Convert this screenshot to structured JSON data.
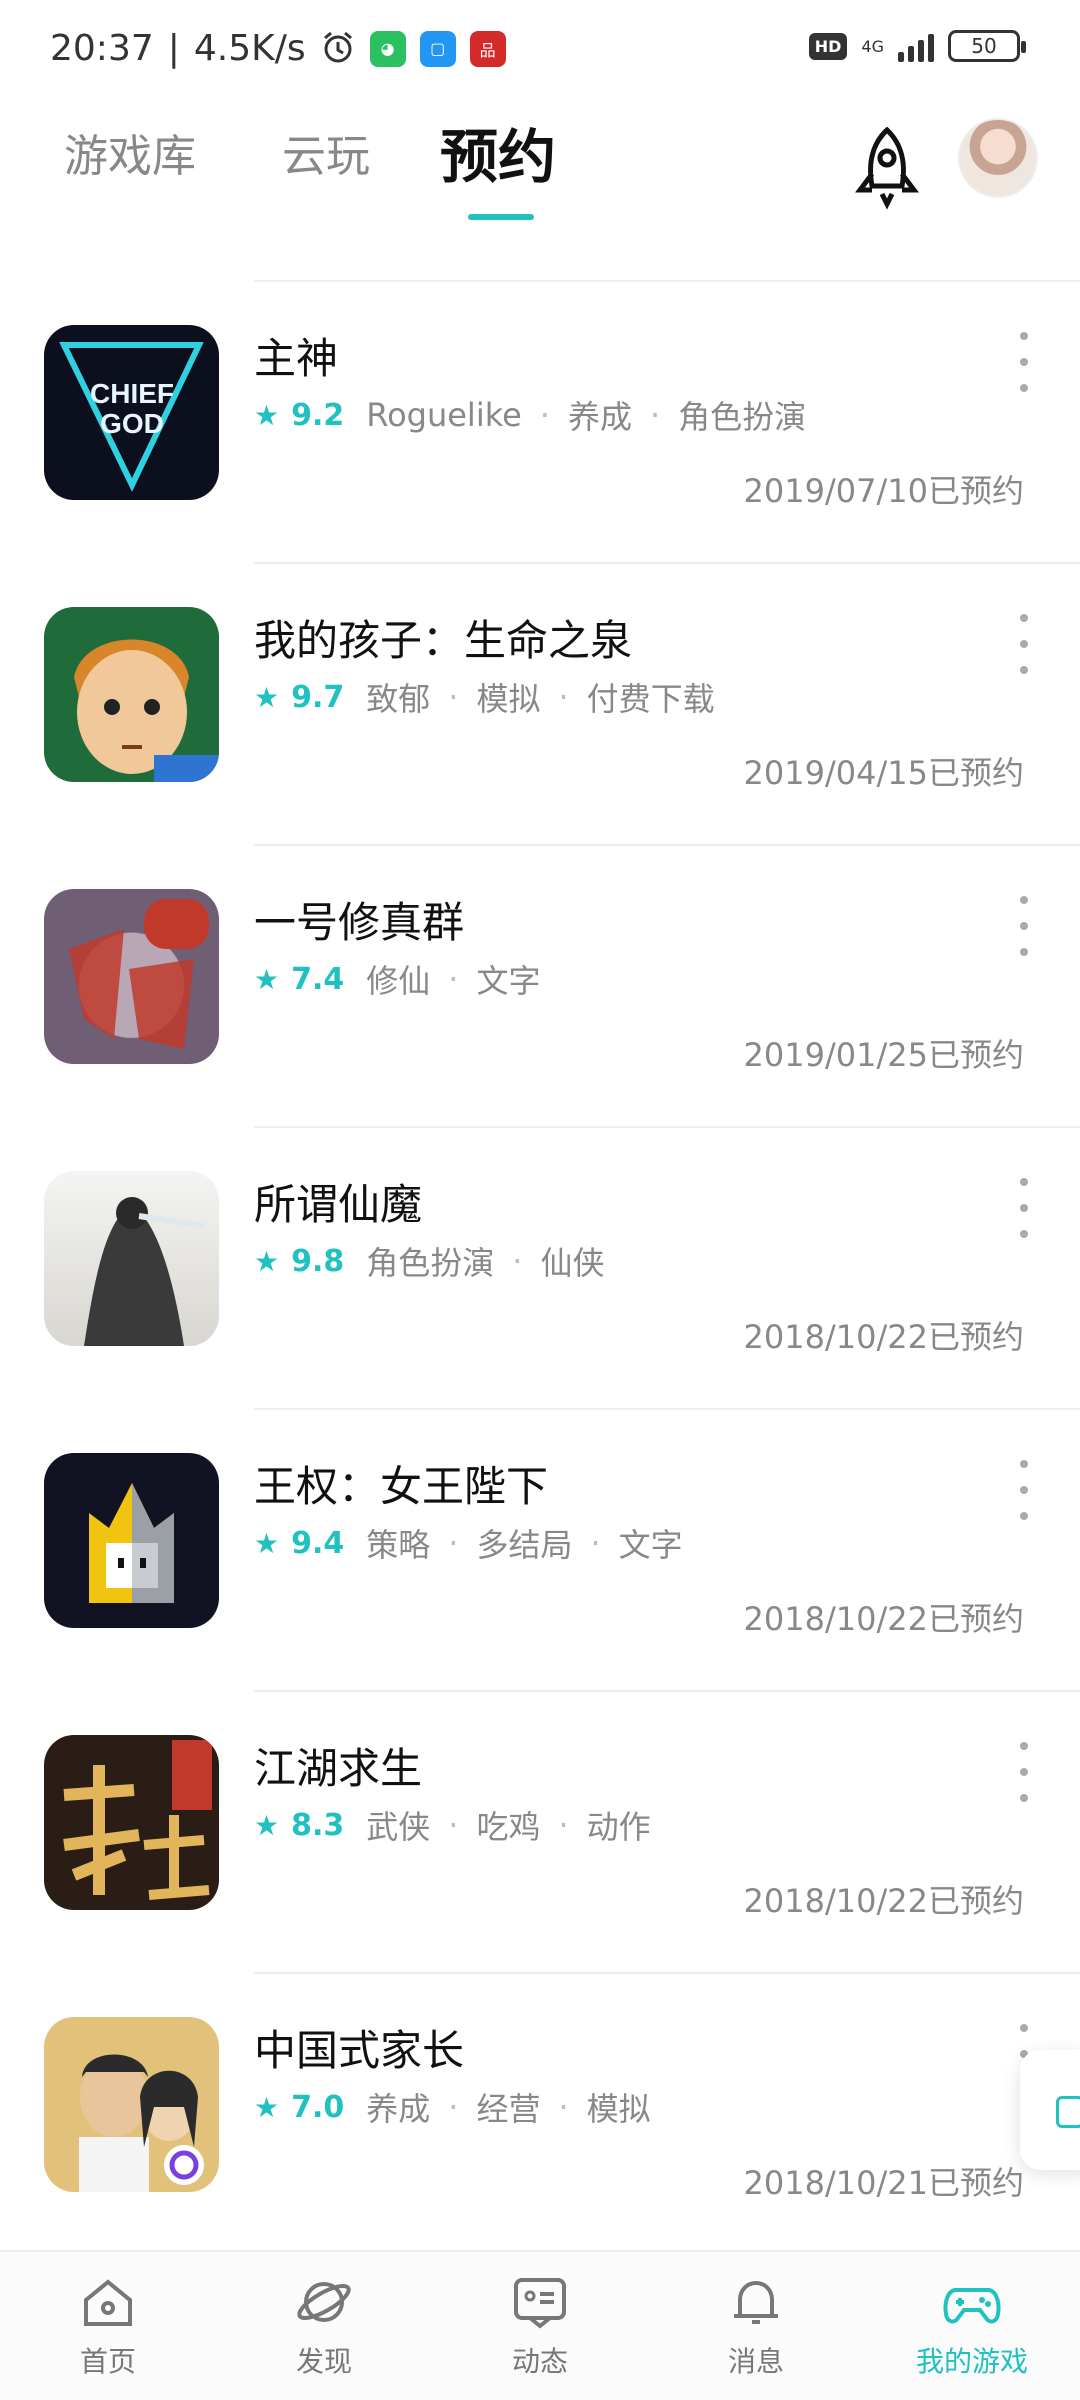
{
  "status_bar": {
    "time": "20:37",
    "speed": "4.5K/s",
    "network": "4G",
    "hd": "HD",
    "battery": "50"
  },
  "tabs": {
    "items": [
      "游戏库",
      "云玩",
      "预约"
    ],
    "active": "预约"
  },
  "accent_color": "#21c1c1",
  "games": [
    {
      "title": "主神",
      "rating": "9.2",
      "tags": [
        "Roguelike",
        "养成",
        "角色扮演"
      ],
      "date": "2019/07/10已预约",
      "icon": "chief-god-icon"
    },
    {
      "title": "我的孩子：生命之泉",
      "rating": "9.7",
      "tags": [
        "致郁",
        "模拟",
        "付费下载"
      ],
      "date": "2019/04/15已预约",
      "icon": "my-child-icon"
    },
    {
      "title": "一号修真群",
      "rating": "7.4",
      "tags": [
        "修仙",
        "文字"
      ],
      "date": "2019/01/25已预约",
      "icon": "xiuzhen-icon"
    },
    {
      "title": "所谓仙魔",
      "rating": "9.8",
      "tags": [
        "角色扮演",
        "仙侠"
      ],
      "date": "2018/10/22已预约",
      "icon": "xianmo-icon"
    },
    {
      "title": "王权：女王陛下",
      "rating": "9.4",
      "tags": [
        "策略",
        "多结局",
        "文字"
      ],
      "date": "2018/10/22已预约",
      "icon": "reigns-icon"
    },
    {
      "title": "江湖求生",
      "rating": "8.3",
      "tags": [
        "武侠",
        "吃鸡",
        "动作"
      ],
      "date": "2018/10/22已预约",
      "icon": "jianghu-icon"
    },
    {
      "title": "中国式家长",
      "rating": "7.0",
      "tags": [
        "养成",
        "经营",
        "模拟"
      ],
      "date": "2018/10/21已预约",
      "icon": "chinese-parents-icon"
    }
  ],
  "bottom_nav": [
    {
      "label": "首页",
      "icon": "home-icon"
    },
    {
      "label": "发现",
      "icon": "discover-icon"
    },
    {
      "label": "动态",
      "icon": "feed-icon"
    },
    {
      "label": "消息",
      "icon": "bell-icon"
    },
    {
      "label": "我的游戏",
      "icon": "gamepad-icon",
      "active": true
    }
  ]
}
